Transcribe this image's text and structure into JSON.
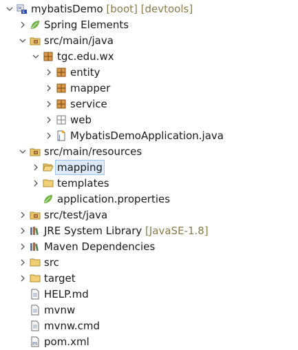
{
  "tree": [
    {
      "id": "project",
      "level": 0,
      "state": "expanded",
      "icon": "maven-project-icon",
      "label": "mybatisDemo",
      "decor": "[boot] [devtools]"
    },
    {
      "id": "spring-elements",
      "level": 1,
      "state": "collapsed",
      "icon": "spring-leaf-icon",
      "label": "Spring Elements"
    },
    {
      "id": "src-main-java",
      "level": 1,
      "state": "expanded",
      "icon": "source-folder-icon",
      "label": "src/main/java"
    },
    {
      "id": "pkg-tgc",
      "level": 2,
      "state": "expanded",
      "icon": "package-icon",
      "label": "tgc.edu.wx"
    },
    {
      "id": "pkg-entity",
      "level": 3,
      "state": "collapsed",
      "icon": "package-icon",
      "label": "entity"
    },
    {
      "id": "pkg-mapper",
      "level": 3,
      "state": "collapsed",
      "icon": "package-icon",
      "label": "mapper"
    },
    {
      "id": "pkg-service",
      "level": 3,
      "state": "collapsed",
      "icon": "package-icon",
      "label": "service"
    },
    {
      "id": "pkg-web",
      "level": 3,
      "state": "collapsed",
      "icon": "empty-package-icon",
      "label": "web"
    },
    {
      "id": "main-class",
      "level": 3,
      "state": "collapsed",
      "icon": "java-file-icon",
      "label": "MybatisDemoApplication.java"
    },
    {
      "id": "src-main-resources",
      "level": 1,
      "state": "expanded",
      "icon": "source-folder-icon",
      "label": "src/main/resources"
    },
    {
      "id": "folder-mapping",
      "level": 2,
      "state": "collapsed",
      "icon": "open-folder-icon",
      "label": "mapping",
      "selected": true
    },
    {
      "id": "folder-templates",
      "level": 2,
      "state": "collapsed",
      "icon": "folder-icon",
      "label": "templates"
    },
    {
      "id": "app-properties",
      "level": 2,
      "state": "none",
      "icon": "spring-leaf-icon",
      "label": "application.properties"
    },
    {
      "id": "src-test-java",
      "level": 1,
      "state": "collapsed",
      "icon": "source-folder-icon",
      "label": "src/test/java"
    },
    {
      "id": "jre-library",
      "level": 1,
      "state": "collapsed",
      "icon": "library-icon",
      "label": "JRE System Library",
      "decor": "[JavaSE-1.8]"
    },
    {
      "id": "maven-deps",
      "level": 1,
      "state": "collapsed",
      "icon": "library-icon",
      "label": "Maven Dependencies"
    },
    {
      "id": "folder-src",
      "level": 1,
      "state": "collapsed",
      "icon": "folder-icon",
      "label": "src"
    },
    {
      "id": "folder-target",
      "level": 1,
      "state": "collapsed",
      "icon": "folder-icon",
      "label": "target"
    },
    {
      "id": "help-md",
      "level": 1,
      "state": "none",
      "icon": "text-file-icon",
      "label": "HELP.md"
    },
    {
      "id": "mvnw",
      "level": 1,
      "state": "none",
      "icon": "text-file-icon",
      "label": "mvnw"
    },
    {
      "id": "mvnw-cmd",
      "level": 1,
      "state": "none",
      "icon": "text-file-icon",
      "label": "mvnw.cmd"
    },
    {
      "id": "pom-xml",
      "level": 1,
      "state": "none",
      "icon": "maven-file-icon",
      "label": "pom.xml"
    }
  ]
}
